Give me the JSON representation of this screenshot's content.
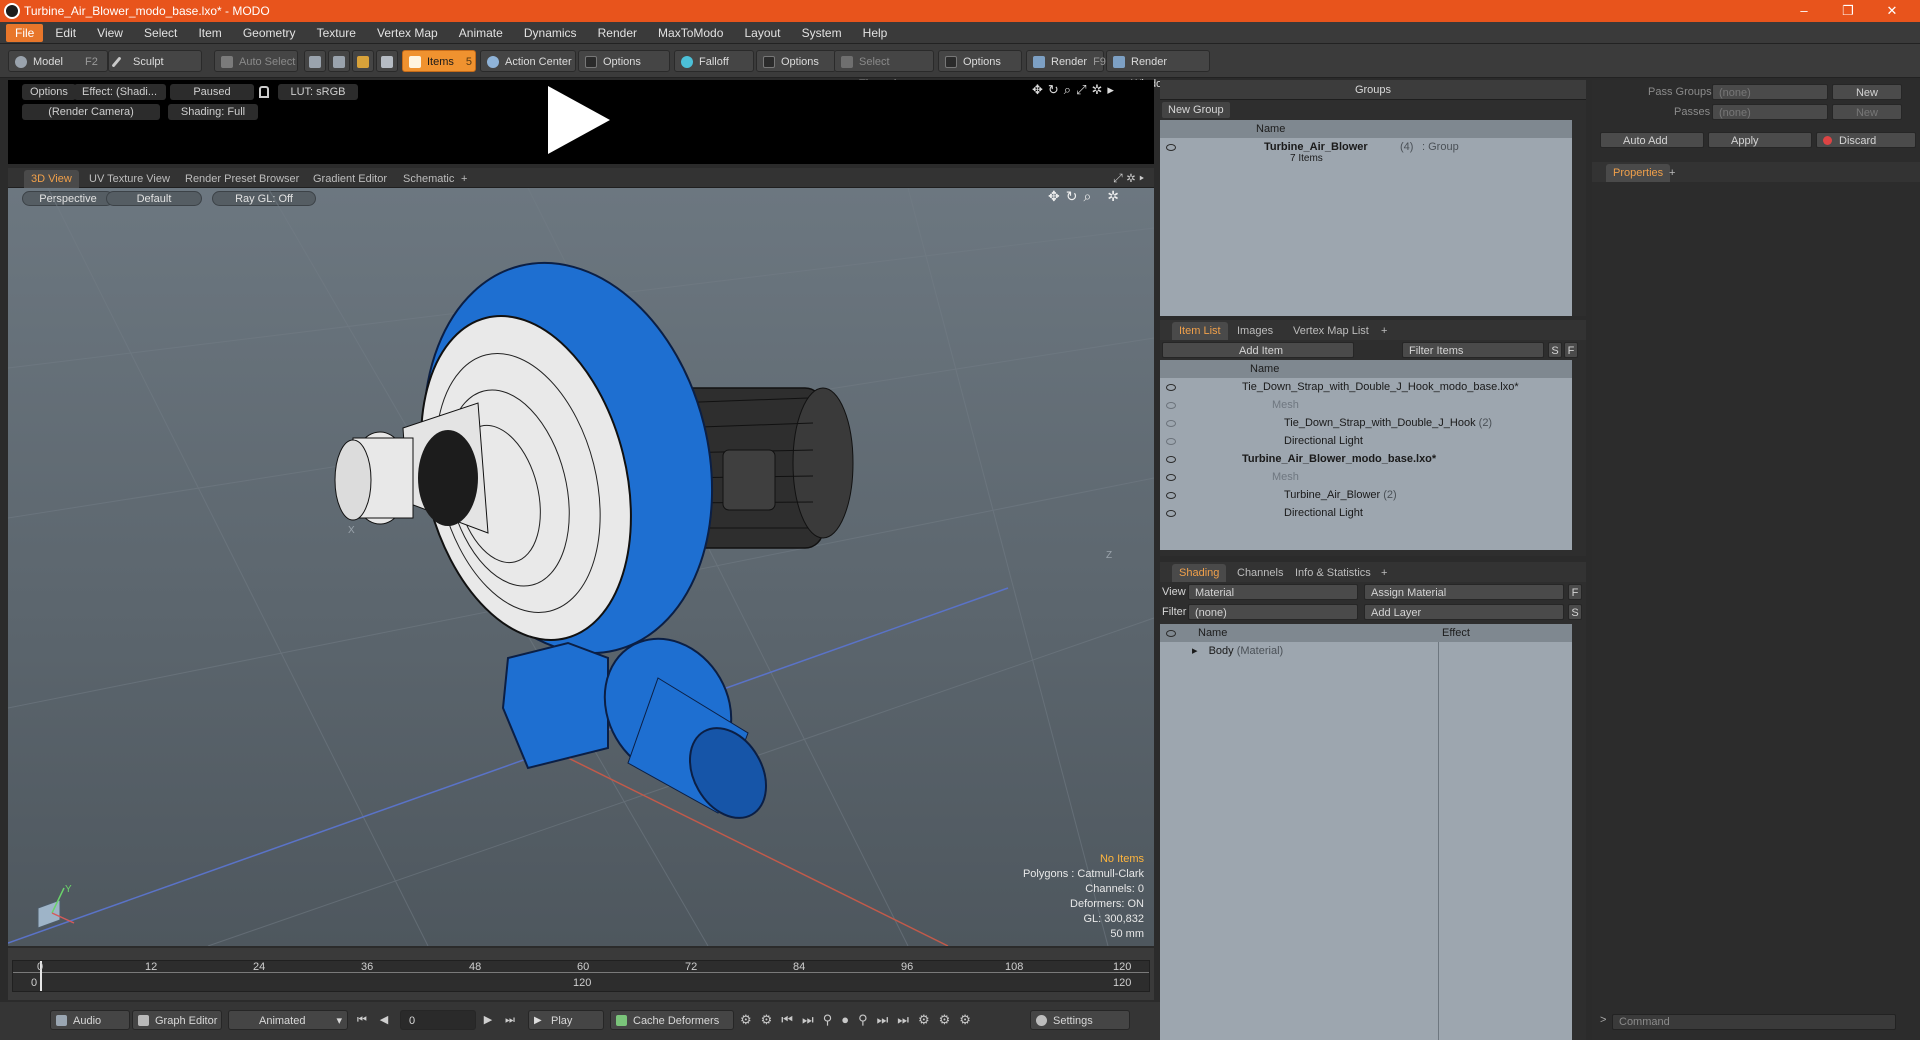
{
  "window": {
    "title": "Turbine_Air_Blower_modo_base.lxo* - MODO",
    "minimize": "–",
    "maximize": "❐",
    "close": "✕"
  },
  "menu": [
    "File",
    "Edit",
    "View",
    "Select",
    "Item",
    "Geometry",
    "Texture",
    "Vertex Map",
    "Animate",
    "Dynamics",
    "Render",
    "MaxToModo",
    "Layout",
    "System",
    "Help"
  ],
  "toolbar": {
    "model": "Model",
    "model_key": "F2",
    "sculpt": "Sculpt",
    "auto_select": "Auto Select",
    "items": "Items",
    "items_key": "5",
    "action_center": "Action Center",
    "options1": "Options",
    "falloff": "Falloff",
    "options2": "Options",
    "select_through": "Select Through",
    "options3": "Options",
    "render": "Render",
    "render_key": "F9",
    "render_window": "Render Window"
  },
  "preview": {
    "options": "Options",
    "effect": "Effect: (Shadi...",
    "paused": "Paused",
    "lut": "LUT: sRGB",
    "camera": "(Render Camera)",
    "shading": "Shading: Full"
  },
  "view_tabs": [
    "3D View",
    "UV Texture View",
    "Render Preset Browser",
    "Gradient Editor",
    "Schematic",
    "+"
  ],
  "viewport": {
    "perspective": "Perspective",
    "default": "Default",
    "raygl": "Ray GL: Off",
    "axis_x": "X",
    "axis_z": "Z",
    "axis_y": "Y",
    "hud": {
      "no_items": "No Items",
      "polygons": "Polygons : Catmull-Clark",
      "channels": "Channels: 0",
      "deformers": "Deformers: ON",
      "gl": "GL: 300,832",
      "mm": "50 mm"
    }
  },
  "timeline": {
    "top_ticks": [
      "0",
      "12",
      "24",
      "36",
      "48",
      "60",
      "72",
      "84",
      "96",
      "108",
      "120"
    ],
    "bottom_ticks": [
      "0",
      "120",
      "120"
    ]
  },
  "bottombar": {
    "audio": "Audio",
    "graph_editor": "Graph Editor",
    "animated": "Animated",
    "frame": "0",
    "play": "Play",
    "cache_deformers": "Cache Deformers",
    "settings": "Settings"
  },
  "groups": {
    "title": "Groups",
    "new_group": "New Group",
    "col_name": "Name",
    "item_name": "Turbine_Air_Blower",
    "item_count": "(4)",
    "item_type": ": Group",
    "item_sub": "7 Items"
  },
  "passes": {
    "pass_groups_label": "Pass Groups",
    "pass_groups_value": "(none)",
    "passes_label": "Passes",
    "passes_value": "(none)",
    "new1": "New",
    "new2": "New",
    "auto_add": "Auto Add",
    "apply": "Apply",
    "discard": "Discard",
    "properties_tab": "Properties",
    "plus": "+"
  },
  "itemlist": {
    "tabs": [
      "Item List",
      "Images",
      "Vertex Map List",
      "+"
    ],
    "add_item": "Add Item",
    "filter_items": "Filter Items",
    "s": "S",
    "f": "F",
    "col_name": "Name",
    "rows": [
      {
        "name": "Tie_Down_Strap_with_Double_J_Hook_modo_base.lxo*",
        "suffix": "",
        "bold": false
      },
      {
        "name": "Mesh",
        "suffix": "",
        "bold": false
      },
      {
        "name": "Tie_Down_Strap_with_Double_J_Hook",
        "suffix": "(2)",
        "bold": false
      },
      {
        "name": "Directional Light",
        "suffix": "",
        "bold": false
      },
      {
        "name": "Turbine_Air_Blower_modo_base.lxo*",
        "suffix": "",
        "bold": true
      },
      {
        "name": "Mesh",
        "suffix": "",
        "bold": false
      },
      {
        "name": "Turbine_Air_Blower",
        "suffix": "(2)",
        "bold": false
      },
      {
        "name": "Directional Light",
        "suffix": "",
        "bold": false
      }
    ]
  },
  "shading": {
    "tabs": [
      "Shading",
      "Channels",
      "Info & Statistics",
      "+"
    ],
    "view_label": "View",
    "view_value": "Material",
    "assign_material": "Assign Material",
    "filter_label": "Filter",
    "filter_value": "(none)",
    "add_layer": "Add Layer",
    "f": "F",
    "s": "S",
    "col_name": "Name",
    "col_effect": "Effect",
    "row_name": "Body",
    "row_type": "(Material)"
  },
  "command": {
    "placeholder": "Command",
    "prompt": ">"
  },
  "colors": {
    "accent": "#e8541c",
    "active_tab": "#f0a04a",
    "mesh_blue": "#1e6fd1"
  }
}
